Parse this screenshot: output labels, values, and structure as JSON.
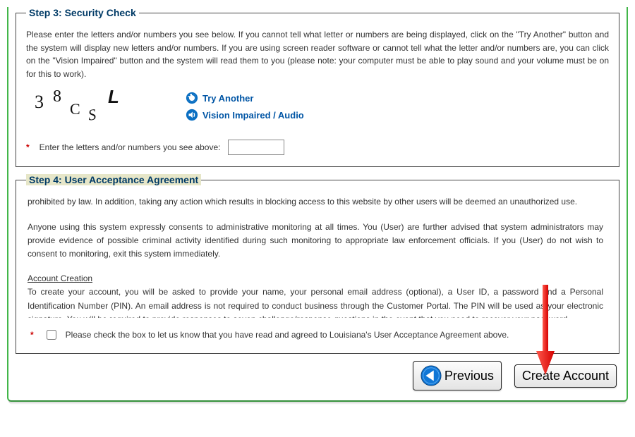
{
  "step3": {
    "legend": "Step 3: Security Check",
    "instructions": "Please enter the letters and/or numbers you see below. If you cannot tell what letter or numbers are being displayed, click on the \"Try Another\" button and the system will display new letters and/or numbers. If you are using screen reader software or cannot tell what the letter and/or numbers are, you can click on the \"Vision Impaired\" button and the system will read them to you (please note: your computer must be able to play sound and your volume must be on for this to work).",
    "captcha_chars": [
      "3",
      "8",
      "C",
      "S",
      "L"
    ],
    "links": {
      "try_another": "Try Another",
      "vision_impaired": "Vision Impaired / Audio"
    },
    "fieldLabel": "Enter the letters and/or numbers you see above:",
    "input_value": ""
  },
  "step4": {
    "legend": "Step 4: User Acceptance Agreement",
    "body": {
      "p1": "prohibited by law. In addition, taking any action which results in blocking access to this website by other users will be deemed an unauthorized use.",
      "p2": "Anyone using this system expressly consents to administrative monitoring at all times. You (User) are further advised that system administrators may provide evidence of possible criminal activity identified during such monitoring to appropriate law enforcement officials. If you (User) do not wish to consent to monitoring, exit this system immediately.",
      "h1": "Account Creation",
      "p3": "To create your account, you will be asked to provide your name, your personal email address (optional), a User ID, a password and a Personal Identification Number (PIN). An email address is not required to conduct business through the Customer Portal. The PIN will be used as your electronic signature. You will be required to provide responses to seven challenge/response questions in the event that you need to recover your password."
    },
    "accept_label": "Please check the box to let us know that you have read and agreed to Louisiana's User Acceptance Agreement above."
  },
  "buttons": {
    "previous": "Previous",
    "create": "Create Account"
  }
}
